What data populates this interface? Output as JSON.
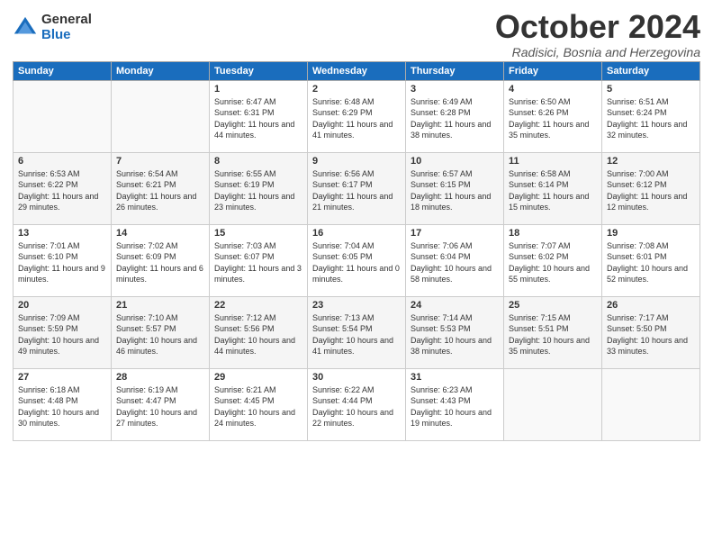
{
  "logo": {
    "general": "General",
    "blue": "Blue"
  },
  "title": "October 2024",
  "location": "Radisici, Bosnia and Herzegovina",
  "days_of_week": [
    "Sunday",
    "Monday",
    "Tuesday",
    "Wednesday",
    "Thursday",
    "Friday",
    "Saturday"
  ],
  "weeks": [
    [
      {
        "day": "",
        "sunrise": "",
        "sunset": "",
        "daylight": ""
      },
      {
        "day": "",
        "sunrise": "",
        "sunset": "",
        "daylight": ""
      },
      {
        "day": "1",
        "sunrise": "Sunrise: 6:47 AM",
        "sunset": "Sunset: 6:31 PM",
        "daylight": "Daylight: 11 hours and 44 minutes."
      },
      {
        "day": "2",
        "sunrise": "Sunrise: 6:48 AM",
        "sunset": "Sunset: 6:29 PM",
        "daylight": "Daylight: 11 hours and 41 minutes."
      },
      {
        "day": "3",
        "sunrise": "Sunrise: 6:49 AM",
        "sunset": "Sunset: 6:28 PM",
        "daylight": "Daylight: 11 hours and 38 minutes."
      },
      {
        "day": "4",
        "sunrise": "Sunrise: 6:50 AM",
        "sunset": "Sunset: 6:26 PM",
        "daylight": "Daylight: 11 hours and 35 minutes."
      },
      {
        "day": "5",
        "sunrise": "Sunrise: 6:51 AM",
        "sunset": "Sunset: 6:24 PM",
        "daylight": "Daylight: 11 hours and 32 minutes."
      }
    ],
    [
      {
        "day": "6",
        "sunrise": "Sunrise: 6:53 AM",
        "sunset": "Sunset: 6:22 PM",
        "daylight": "Daylight: 11 hours and 29 minutes."
      },
      {
        "day": "7",
        "sunrise": "Sunrise: 6:54 AM",
        "sunset": "Sunset: 6:21 PM",
        "daylight": "Daylight: 11 hours and 26 minutes."
      },
      {
        "day": "8",
        "sunrise": "Sunrise: 6:55 AM",
        "sunset": "Sunset: 6:19 PM",
        "daylight": "Daylight: 11 hours and 23 minutes."
      },
      {
        "day": "9",
        "sunrise": "Sunrise: 6:56 AM",
        "sunset": "Sunset: 6:17 PM",
        "daylight": "Daylight: 11 hours and 21 minutes."
      },
      {
        "day": "10",
        "sunrise": "Sunrise: 6:57 AM",
        "sunset": "Sunset: 6:15 PM",
        "daylight": "Daylight: 11 hours and 18 minutes."
      },
      {
        "day": "11",
        "sunrise": "Sunrise: 6:58 AM",
        "sunset": "Sunset: 6:14 PM",
        "daylight": "Daylight: 11 hours and 15 minutes."
      },
      {
        "day": "12",
        "sunrise": "Sunrise: 7:00 AM",
        "sunset": "Sunset: 6:12 PM",
        "daylight": "Daylight: 11 hours and 12 minutes."
      }
    ],
    [
      {
        "day": "13",
        "sunrise": "Sunrise: 7:01 AM",
        "sunset": "Sunset: 6:10 PM",
        "daylight": "Daylight: 11 hours and 9 minutes."
      },
      {
        "day": "14",
        "sunrise": "Sunrise: 7:02 AM",
        "sunset": "Sunset: 6:09 PM",
        "daylight": "Daylight: 11 hours and 6 minutes."
      },
      {
        "day": "15",
        "sunrise": "Sunrise: 7:03 AM",
        "sunset": "Sunset: 6:07 PM",
        "daylight": "Daylight: 11 hours and 3 minutes."
      },
      {
        "day": "16",
        "sunrise": "Sunrise: 7:04 AM",
        "sunset": "Sunset: 6:05 PM",
        "daylight": "Daylight: 11 hours and 0 minutes."
      },
      {
        "day": "17",
        "sunrise": "Sunrise: 7:06 AM",
        "sunset": "Sunset: 6:04 PM",
        "daylight": "Daylight: 10 hours and 58 minutes."
      },
      {
        "day": "18",
        "sunrise": "Sunrise: 7:07 AM",
        "sunset": "Sunset: 6:02 PM",
        "daylight": "Daylight: 10 hours and 55 minutes."
      },
      {
        "day": "19",
        "sunrise": "Sunrise: 7:08 AM",
        "sunset": "Sunset: 6:01 PM",
        "daylight": "Daylight: 10 hours and 52 minutes."
      }
    ],
    [
      {
        "day": "20",
        "sunrise": "Sunrise: 7:09 AM",
        "sunset": "Sunset: 5:59 PM",
        "daylight": "Daylight: 10 hours and 49 minutes."
      },
      {
        "day": "21",
        "sunrise": "Sunrise: 7:10 AM",
        "sunset": "Sunset: 5:57 PM",
        "daylight": "Daylight: 10 hours and 46 minutes."
      },
      {
        "day": "22",
        "sunrise": "Sunrise: 7:12 AM",
        "sunset": "Sunset: 5:56 PM",
        "daylight": "Daylight: 10 hours and 44 minutes."
      },
      {
        "day": "23",
        "sunrise": "Sunrise: 7:13 AM",
        "sunset": "Sunset: 5:54 PM",
        "daylight": "Daylight: 10 hours and 41 minutes."
      },
      {
        "day": "24",
        "sunrise": "Sunrise: 7:14 AM",
        "sunset": "Sunset: 5:53 PM",
        "daylight": "Daylight: 10 hours and 38 minutes."
      },
      {
        "day": "25",
        "sunrise": "Sunrise: 7:15 AM",
        "sunset": "Sunset: 5:51 PM",
        "daylight": "Daylight: 10 hours and 35 minutes."
      },
      {
        "day": "26",
        "sunrise": "Sunrise: 7:17 AM",
        "sunset": "Sunset: 5:50 PM",
        "daylight": "Daylight: 10 hours and 33 minutes."
      }
    ],
    [
      {
        "day": "27",
        "sunrise": "Sunrise: 6:18 AM",
        "sunset": "Sunset: 4:48 PM",
        "daylight": "Daylight: 10 hours and 30 minutes."
      },
      {
        "day": "28",
        "sunrise": "Sunrise: 6:19 AM",
        "sunset": "Sunset: 4:47 PM",
        "daylight": "Daylight: 10 hours and 27 minutes."
      },
      {
        "day": "29",
        "sunrise": "Sunrise: 6:21 AM",
        "sunset": "Sunset: 4:45 PM",
        "daylight": "Daylight: 10 hours and 24 minutes."
      },
      {
        "day": "30",
        "sunrise": "Sunrise: 6:22 AM",
        "sunset": "Sunset: 4:44 PM",
        "daylight": "Daylight: 10 hours and 22 minutes."
      },
      {
        "day": "31",
        "sunrise": "Sunrise: 6:23 AM",
        "sunset": "Sunset: 4:43 PM",
        "daylight": "Daylight: 10 hours and 19 minutes."
      },
      {
        "day": "",
        "sunrise": "",
        "sunset": "",
        "daylight": ""
      },
      {
        "day": "",
        "sunrise": "",
        "sunset": "",
        "daylight": ""
      }
    ]
  ]
}
